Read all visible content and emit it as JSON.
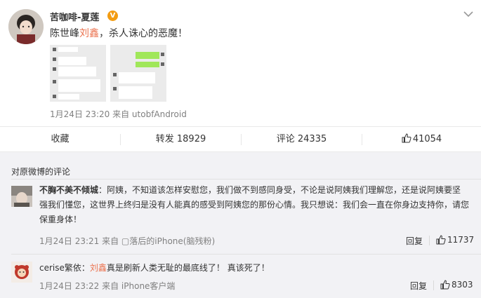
{
  "post": {
    "author": "苦咖啡-夏莲",
    "verified_badge": "V",
    "text_prefix": "陈世峰",
    "mention": "刘鑫",
    "text_suffix": "，杀人诛心的恶魔！",
    "meta": "1月24日 23:20 来自 utobfAndroid",
    "menu_icon": "chevron-down-icon"
  },
  "actions": {
    "favorite": "收藏",
    "repost": "转发 18929",
    "comment": "评论 24335",
    "like": "41054"
  },
  "comments_section": {
    "title": "对原微博的评论"
  },
  "comments": [
    {
      "name": "不胸不美不倾城",
      "sep": "：",
      "line1": "阿姨，不知道该怎样安慰您，我们做不到感同身受，不论是说阿姨我们理解您，还是说阿姨要坚",
      "line2": "强我们懂您，这世界上终归是没有人能真的感受到阿姨您的那份心情。我只想说：我们会一直在你身边支持你，请您",
      "line3": "保重身体！",
      "meta": "1月24日 23:21 来自 ▢落后的iPhone(脑残粉)",
      "reply": "回复",
      "likes": "11737"
    },
    {
      "name": "cerise繁依",
      "sep": "：",
      "mention": "刘鑫",
      "text": "真是刷新人类无耻的最底线了！ 真该死了！",
      "meta": "1月24日 23:22 来自 iPhone客户端",
      "reply": "回复",
      "likes": "8303"
    }
  ],
  "colors": {
    "mention": "#eb7350",
    "meta": "#808080",
    "comment_bg": "#f2f2f5"
  }
}
